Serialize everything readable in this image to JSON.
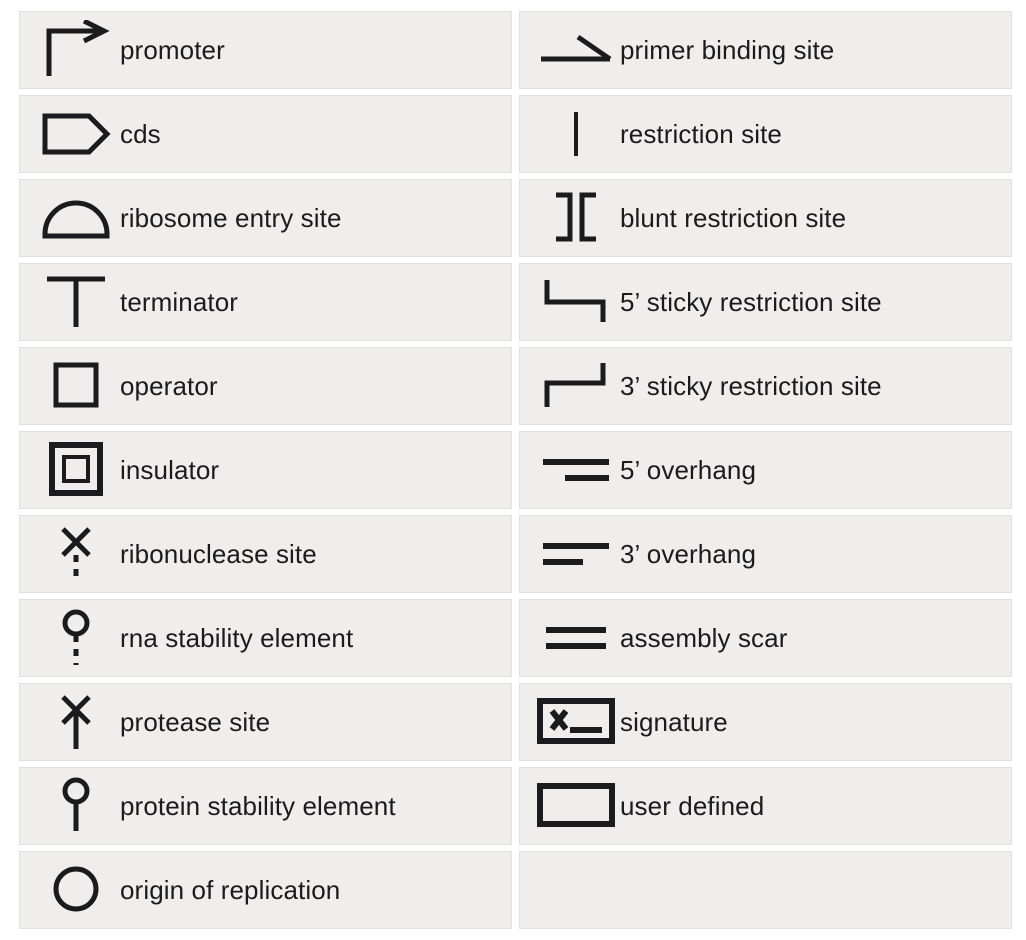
{
  "legend": {
    "columns": 2,
    "colors": {
      "page_background": "#ffffff",
      "cell_background": "#efeeec",
      "cell_border": "#e2e1df",
      "glyph_stroke": "#1b1b1d",
      "label_text": "#1b1b1d"
    },
    "left_column": [
      {
        "icon": "promoter-icon",
        "label": "promoter"
      },
      {
        "icon": "cds-icon",
        "label": "cds"
      },
      {
        "icon": "ribosome-entry-site-icon",
        "label": "ribosome entry site"
      },
      {
        "icon": "terminator-icon",
        "label": "terminator"
      },
      {
        "icon": "operator-icon",
        "label": "operator"
      },
      {
        "icon": "insulator-icon",
        "label": "insulator"
      },
      {
        "icon": "ribonuclease-site-icon",
        "label": "ribonuclease site"
      },
      {
        "icon": "rna-stability-element-icon",
        "label": "rna stability element"
      },
      {
        "icon": "protease-site-icon",
        "label": "protease site"
      },
      {
        "icon": "protein-stability-element-icon",
        "label": "protein stability element"
      },
      {
        "icon": "origin-of-replication-icon",
        "label": "origin of replication"
      }
    ],
    "right_column": [
      {
        "icon": "primer-binding-site-icon",
        "label": "primer binding site"
      },
      {
        "icon": "restriction-site-icon",
        "label": "restriction site"
      },
      {
        "icon": "blunt-restriction-site-icon",
        "label": "blunt restriction site"
      },
      {
        "icon": "five-prime-sticky-restriction-site-icon",
        "label": "5’ sticky restriction site"
      },
      {
        "icon": "three-prime-sticky-restriction-site-icon",
        "label": "3’ sticky restriction site"
      },
      {
        "icon": "five-prime-overhang-icon",
        "label": "5’ overhang"
      },
      {
        "icon": "three-prime-overhang-icon",
        "label": "3’ overhang"
      },
      {
        "icon": "assembly-scar-icon",
        "label": "assembly scar"
      },
      {
        "icon": "signature-icon",
        "label": "signature"
      },
      {
        "icon": "user-defined-icon",
        "label": "user defined"
      },
      {
        "icon": "",
        "label": ""
      }
    ]
  }
}
